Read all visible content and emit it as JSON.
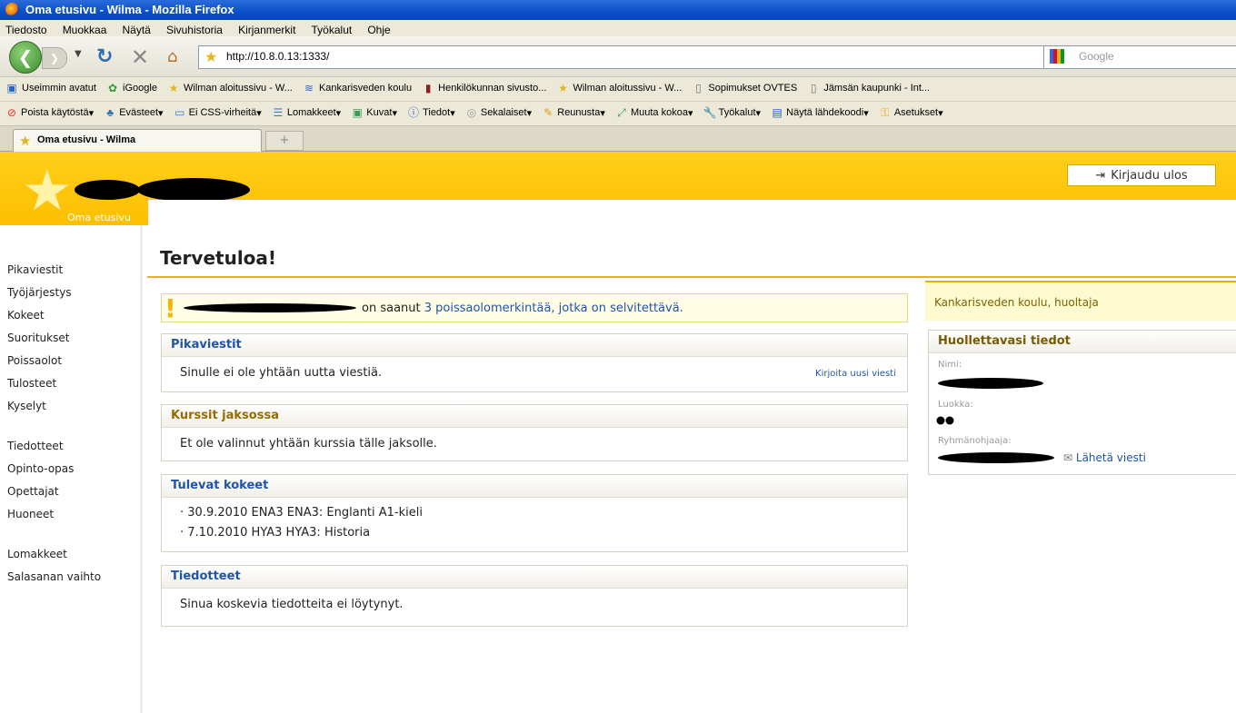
{
  "window": {
    "title": "Oma etusivu - Wilma - Mozilla Firefox"
  },
  "menu": [
    "Tiedosto",
    "Muokkaa",
    "Näytä",
    "Sivuhistoria",
    "Kirjanmerkit",
    "Työkalut",
    "Ohje"
  ],
  "nav": {
    "url": "http://10.8.0.13:1333/",
    "search_placeholder": "Google"
  },
  "bookmarks": [
    "Useimmin avatut",
    "iGoogle",
    "Wilman aloitussivu - W...",
    "Kankarisveden koulu",
    "Henkilökunnan sivusto...",
    "Wilman aloitussivu - W...",
    "Sopimukset OVTES",
    "Jämsän kaupunki - Int..."
  ],
  "webdev": [
    "Poista käytöstä",
    "Evästeet",
    "Ei CSS-virheitä",
    "Lomakkeet",
    "Kuvat",
    "Tiedot",
    "Sekalaiset",
    "Reunusta",
    "Muuta kokoa",
    "Työkalut",
    "Näytä lähdekoodi",
    "Asetukset"
  ],
  "tab": {
    "label": "Oma etusivu - Wilma",
    "new_tab": "+"
  },
  "header": {
    "home_link": "Oma etusivu",
    "logout": "Kirjaudu ulos"
  },
  "sidebar": {
    "group1": [
      "Pikaviestit",
      "Työjärjestys",
      "Kokeet",
      "Suoritukset",
      "Poissaolot",
      "Tulosteet",
      "Kyselyt"
    ],
    "group2": [
      "Tiedotteet",
      "Opinto-opas",
      "Opettajat",
      "Huoneet"
    ],
    "group3": [
      "Lomakkeet",
      "Salasanan vaihto"
    ]
  },
  "main": {
    "title": "Tervetuloa!",
    "alert": {
      "prefix": "on saanut",
      "link": "3 poissaolomerkintää, jotka on selvitettävä."
    },
    "messages": {
      "heading": "Pikaviestit",
      "text": "Sinulle ei ole yhtään uutta viestiä.",
      "new_link": "Kirjoita uusi viesti"
    },
    "courses": {
      "heading": "Kurssit jaksossa",
      "text": "Et ole valinnut yhtään kurssia tälle jaksolle."
    },
    "exams": {
      "heading": "Tulevat kokeet",
      "items": [
        "· 30.9.2010 ENA3 ENA3: Englanti A1-kieli",
        "· 7.10.2010 HYA3 HYA3: Historia"
      ]
    },
    "notices": {
      "heading": "Tiedotteet",
      "text": "Sinua koskevia tiedotteita ei löytynyt."
    }
  },
  "right": {
    "banner": "Kankarisveden koulu, huoltaja",
    "heading": "Huollettavasi tiedot",
    "name_label": "Nimi:",
    "class_label": "Luokka:",
    "advisor_label": "Ryhmänohjaaja:",
    "send_link": "Lähetä viesti"
  }
}
